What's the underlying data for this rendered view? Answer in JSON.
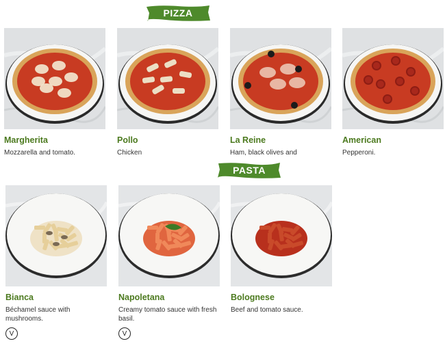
{
  "sections": {
    "pizza": {
      "title": "PIZZA"
    },
    "pasta": {
      "title": "PASTA"
    }
  },
  "pizzas": [
    {
      "name": "Margherita",
      "description": "Mozzarella and tomato.",
      "topping": "plain"
    },
    {
      "name": "Pollo",
      "description": "Chicken",
      "topping": "chicken"
    },
    {
      "name": "La Reine",
      "description": "Ham, black olives and",
      "topping": "olives"
    },
    {
      "name": "American",
      "description": "Pepperoni.",
      "topping": "pepperoni"
    }
  ],
  "pastas": [
    {
      "name": "Bianca",
      "description": "Béchamel sauce with mushrooms.",
      "vegetarian": true,
      "veg_label": "V",
      "sauce": "white"
    },
    {
      "name": "Napoletana",
      "description": "Creamy tomato sauce with fresh basil.",
      "vegetarian": true,
      "veg_label": "V",
      "sauce": "tomato"
    },
    {
      "name": "Bolognese",
      "description": "Beef and tomato sauce.",
      "vegetarian": false,
      "veg_label": "",
      "sauce": "meat"
    }
  ],
  "colors": {
    "brand_green": "#4c7a1f",
    "banner_green": "#4e8a2b",
    "text": "#333333"
  }
}
